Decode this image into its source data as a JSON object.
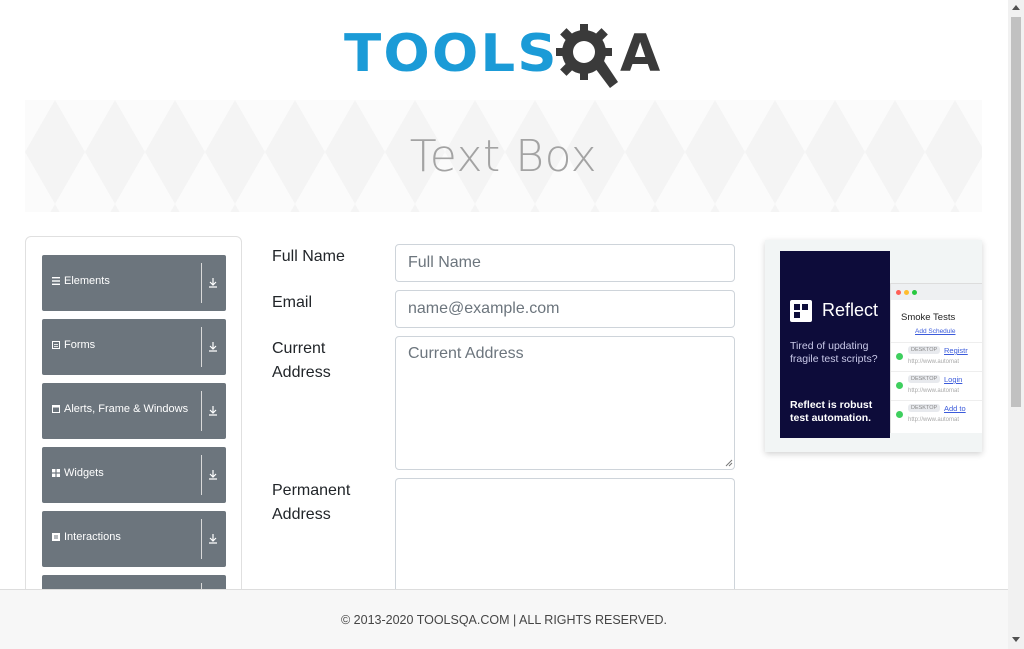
{
  "header": {
    "logo_text_main": "TOOLS",
    "logo_text_q": "Q",
    "logo_text_a": "A"
  },
  "banner": {
    "title": "Text Box"
  },
  "sidebar": {
    "groups": [
      {
        "label": "Elements",
        "icon": "hamburger-icon"
      },
      {
        "label": "Forms",
        "icon": "form-icon"
      },
      {
        "label": "Alerts, Frame & Windows",
        "icon": "window-icon"
      },
      {
        "label": "Widgets",
        "icon": "grid-icon"
      },
      {
        "label": "Interactions",
        "icon": "interaction-icon"
      },
      {
        "label": "",
        "icon": ""
      }
    ]
  },
  "form": {
    "full_name": {
      "label": "Full Name",
      "placeholder": "Full Name",
      "value": ""
    },
    "email": {
      "label": "Email",
      "placeholder": "name@example.com",
      "value": ""
    },
    "current_address": {
      "label_line1": "Current",
      "label_line2": "Address",
      "placeholder": "Current Address",
      "value": ""
    },
    "permanent_address": {
      "label_line1": "Permanent",
      "label_line2": "Address",
      "placeholder": "",
      "value": ""
    }
  },
  "ad": {
    "brand": "Reflect",
    "text1": "Tired of updating fragile test scripts?",
    "text2": "Reflect is robust test automation.",
    "window_title": "Smoke Tests",
    "links": "Add Schedule",
    "rows": [
      {
        "tag": "DESKTOP",
        "name": "Registr",
        "url": "http://www.automat"
      },
      {
        "tag": "DESKTOP",
        "name": "Login",
        "url": "http://www.automat"
      },
      {
        "tag": "DESKTOP",
        "name": "Add to",
        "url": "http://www.automat"
      }
    ],
    "colors": {
      "dark": "#0d0c3a",
      "status_green": "#3ecf5e"
    }
  },
  "footer": {
    "text": "© 2013-2020 TOOLSQA.COM | ALL RIGHTS RESERVED."
  },
  "colors": {
    "brand_blue": "#1b9bd7",
    "sidebar_gray": "#6c757d"
  }
}
